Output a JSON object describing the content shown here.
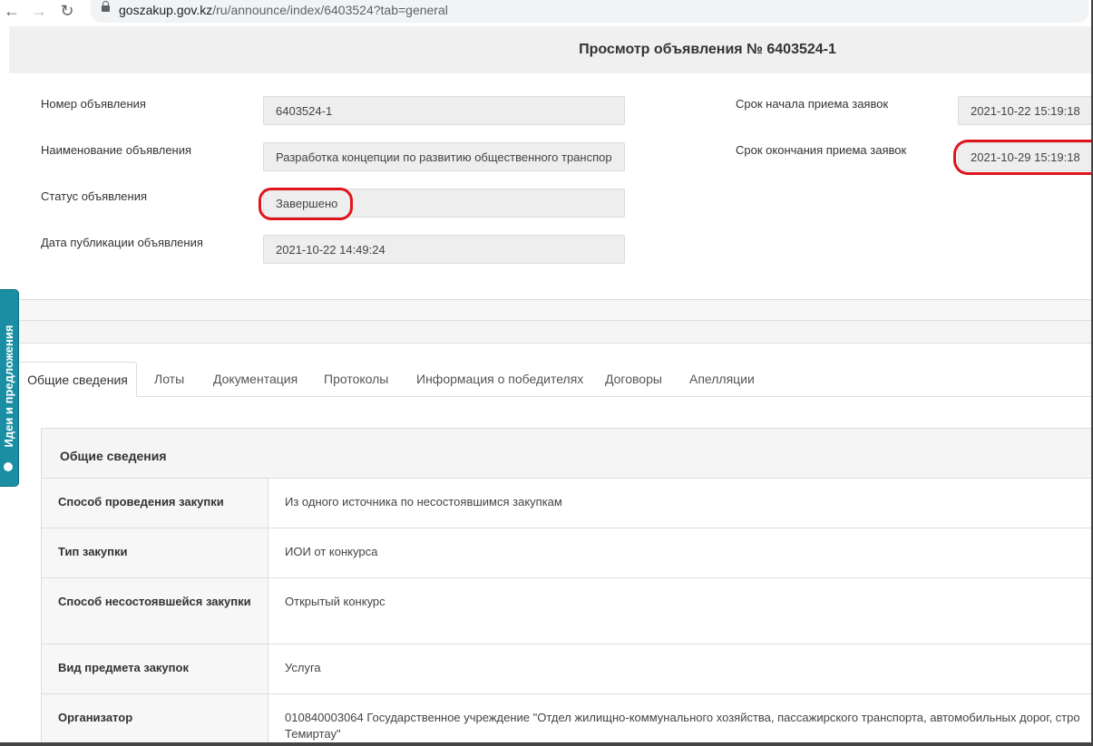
{
  "browser": {
    "url_host": "goszakup.gov.kz",
    "url_path": "/ru/announce/index/6403524?tab=general"
  },
  "page": {
    "title": "Просмотр объявления № 6403524-1"
  },
  "fields_left": [
    {
      "label": "Номер объявления",
      "value": "6403524-1"
    },
    {
      "label": "Наименование объявления",
      "value": "Разработка концепции по развитию общественного транспор"
    },
    {
      "label": "Статус объявления",
      "value": "Завершено"
    },
    {
      "label": "Дата публикации объявления",
      "value": "2021-10-22 14:49:24"
    }
  ],
  "fields_right": [
    {
      "label": "Срок начала приема заявок",
      "value": "2021-10-22 15:19:18"
    },
    {
      "label": "Срок окончания приема заявок",
      "value": "2021-10-29 15:19:18"
    }
  ],
  "tabs": [
    {
      "label": "Общие сведения",
      "active": true
    },
    {
      "label": "Лоты"
    },
    {
      "label": "Документация"
    },
    {
      "label": "Протоколы"
    },
    {
      "label": "Информация о победителях"
    },
    {
      "label": "Договоры"
    },
    {
      "label": "Апелляции"
    }
  ],
  "panel": {
    "title": "Общие сведения",
    "rows": [
      {
        "label": "Способ проведения закупки",
        "value": "Из одного источника по несостоявшимся закупкам"
      },
      {
        "label": "Тип закупки",
        "value": "ИОИ от конкурса"
      },
      {
        "label": "Способ несостоявшейся закупки",
        "value": "Открытый конкурс"
      },
      {
        "label": "Вид предмета закупок",
        "value": "Услуга"
      },
      {
        "label": "Организатор",
        "value": "010840003064 Государственное учреждение \"Отдел жилищно-коммунального хозяйства, пассажирского транспорта, автомобильных дорог, стро",
        "value2": "Темиртау\""
      }
    ]
  },
  "side_widget": {
    "label": "Идеи и предложения"
  },
  "colors": {
    "highlight_oval": "#e0141d",
    "side_widget": "#1a8fa3"
  }
}
